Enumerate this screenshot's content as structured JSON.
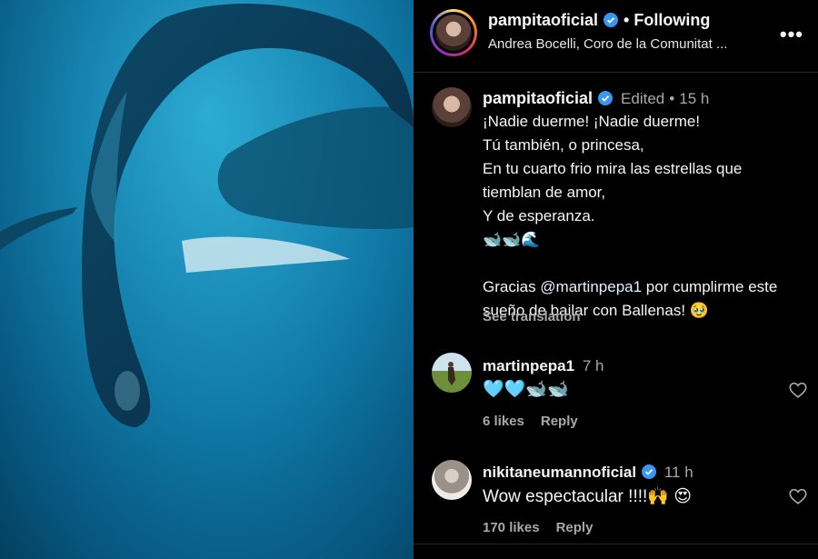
{
  "header": {
    "username": "pampitaoficial",
    "separator": "•",
    "follow_state": "Following",
    "audio": "Andrea Bocelli, Coro de la Comunitat ...",
    "more": "•••",
    "icons": {
      "verified": "verified-badge-icon",
      "more": "more-options-icon"
    }
  },
  "caption": {
    "username": "pampitaoficial",
    "edited": "Edited",
    "separator": "•",
    "time": "15 h",
    "lines": [
      "¡Nadie duerme! ¡Nadie duerme!",
      "Tú también, o princesa,",
      "En tu cuarto frio mira las estrellas que tiemblan de amor,",
      "Y de esperanza.",
      "🐋🐋🌊",
      ""
    ],
    "thanks_prefix": "Gracias ",
    "mention": "@martinpepa1",
    "thanks_suffix": " por cumplirme este sueño de bailar con Ballenas! 🥹",
    "see_translation": "See translation"
  },
  "comments": [
    {
      "username": "martinpepa1",
      "time": "7 h",
      "text": "🩵🩵🐋🐋",
      "likes": "6 likes",
      "reply": "Reply"
    },
    {
      "username": "nikitaneumannoficial",
      "time": "11 h",
      "text": "Wow espectacular !!!!🙌 😍",
      "likes": "170 likes",
      "reply": "Reply"
    }
  ],
  "colors": {
    "background": "#000000",
    "text": "#f5f5f5",
    "muted": "#a8a8a8",
    "verified": "#3897f0",
    "ocean": "#0f78a6"
  }
}
